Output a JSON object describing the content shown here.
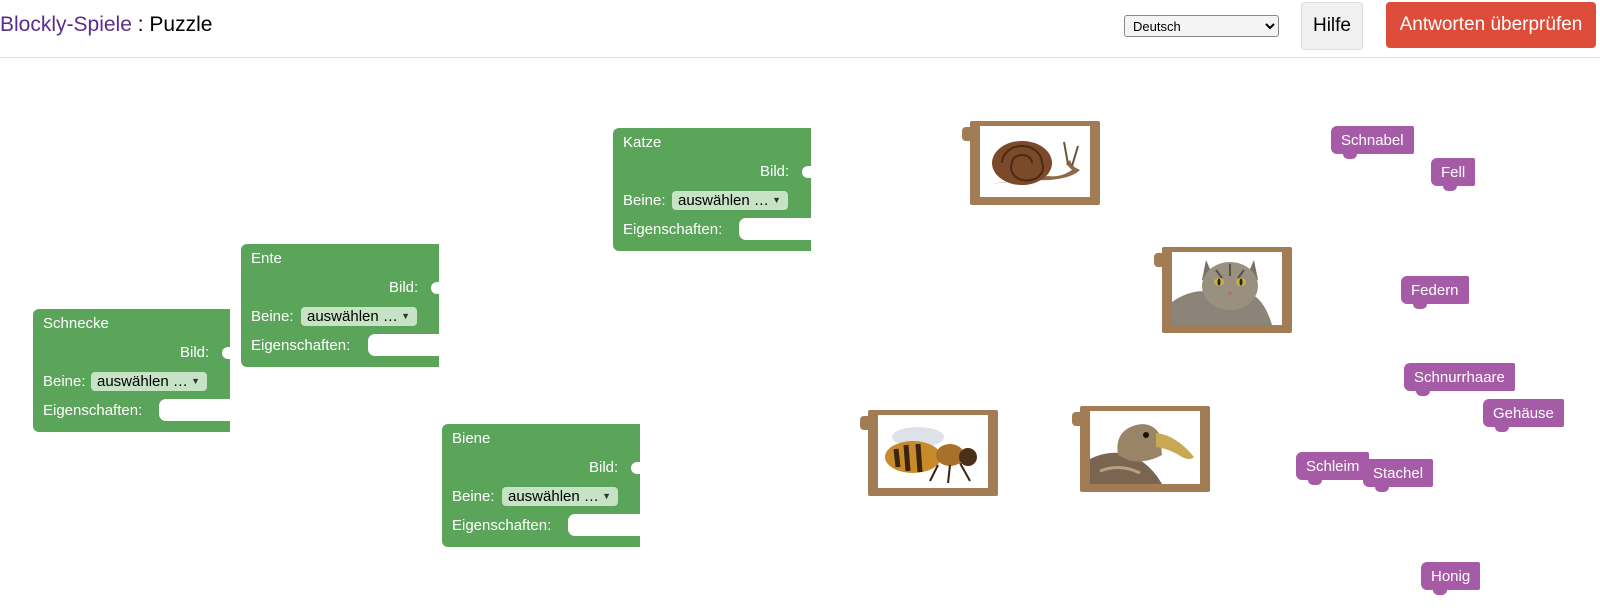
{
  "header": {
    "app_link": "Blockly-Spiele",
    "separator": " : ",
    "page_title": "Puzzle",
    "language": "Deutsch",
    "help_label": "Hilfe",
    "check_label": "Antworten überprüfen"
  },
  "block_fields": {
    "picture": "Bild:",
    "legs": "Beine:",
    "legs_select": "auswählen …",
    "traits": "Eigenschaften:"
  },
  "animals": [
    "Schnecke",
    "Ente",
    "Katze",
    "Biene"
  ],
  "pictures": [
    "snail",
    "cat",
    "bee",
    "duck"
  ],
  "traits": [
    "Schnabel",
    "Fell",
    "Federn",
    "Schnurrhaare",
    "Gehäuse",
    "Schleim",
    "Stachel",
    "Honig"
  ],
  "colors": {
    "animal_block": "#5ba55b",
    "trait_block": "#a55ba5",
    "picture_frame": "#a17c54",
    "check_button": "#dd4b39",
    "app_link": "#5b2c8f"
  }
}
